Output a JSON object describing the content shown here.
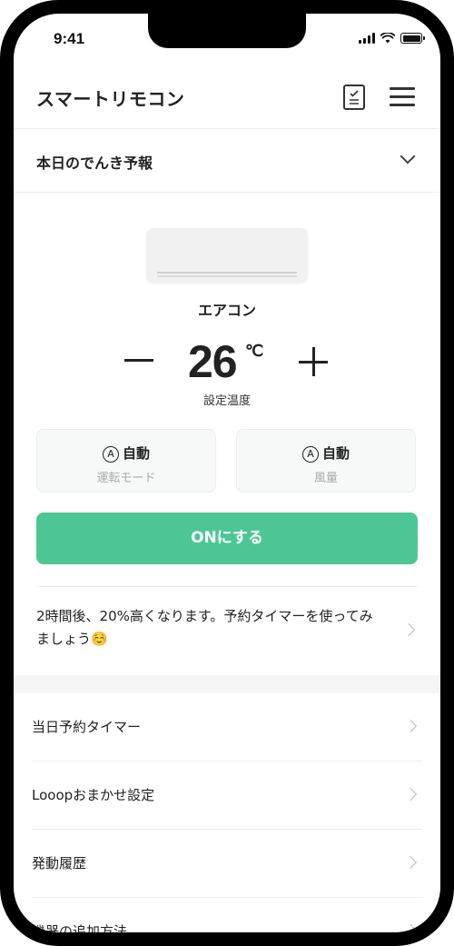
{
  "status_bar": {
    "time": "9:41"
  },
  "header": {
    "title": "スマートリモコン"
  },
  "forecast": {
    "title": "本日のでんき予報"
  },
  "device": {
    "name": "エアコン",
    "temperature": "26",
    "temperature_unit": "℃",
    "temperature_caption": "設定温度"
  },
  "modes": [
    {
      "value": "自動",
      "icon_glyph": "A",
      "label": "運転モード"
    },
    {
      "value": "自動",
      "icon_glyph": "A",
      "label": "風量"
    }
  ],
  "power_button": {
    "label": "ONにする"
  },
  "tip": {
    "text": "2時間後、20%高くなります。予約タイマーを使ってみましょう☺️"
  },
  "menu": {
    "items": [
      {
        "label": "当日予約タイマー"
      },
      {
        "label": "Looopおまかせ設定"
      },
      {
        "label": "発動履歴"
      },
      {
        "label": "機器の追加方法"
      }
    ]
  },
  "colors": {
    "accent": "#4cc794",
    "card_bg": "#f7f8f8",
    "muted_text": "#aaaaaa"
  }
}
